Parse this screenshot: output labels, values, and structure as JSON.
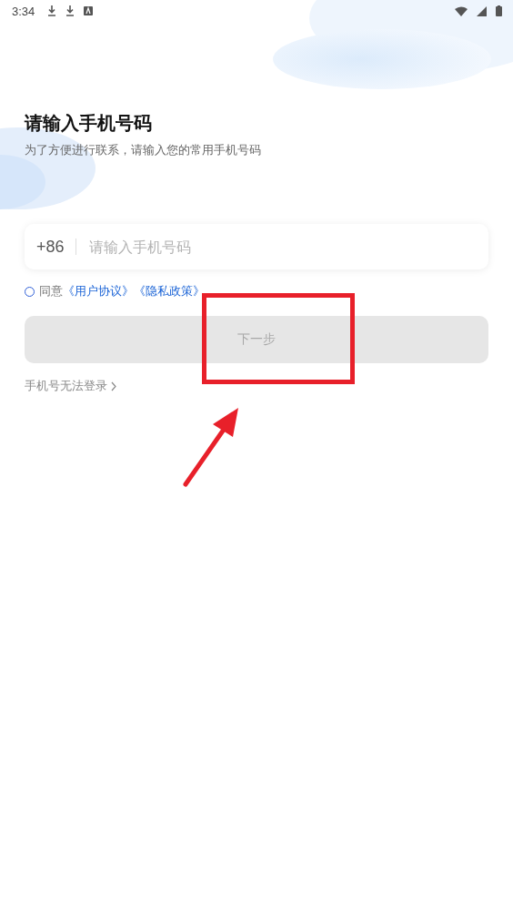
{
  "status_bar": {
    "time": "3:34"
  },
  "title": "请输入手机号码",
  "subtitle": "为了方便进行联系，请输入您的常用手机号码",
  "phone_field": {
    "country_code": "+86",
    "placeholder": "请输入手机号码"
  },
  "agreement": {
    "checked": false,
    "label": "同意",
    "links": [
      "《用户协议》",
      "《隐私政策》"
    ]
  },
  "next_button": {
    "label": "下一步",
    "disabled": true
  },
  "help_link": {
    "label": "手机号无法登录"
  }
}
